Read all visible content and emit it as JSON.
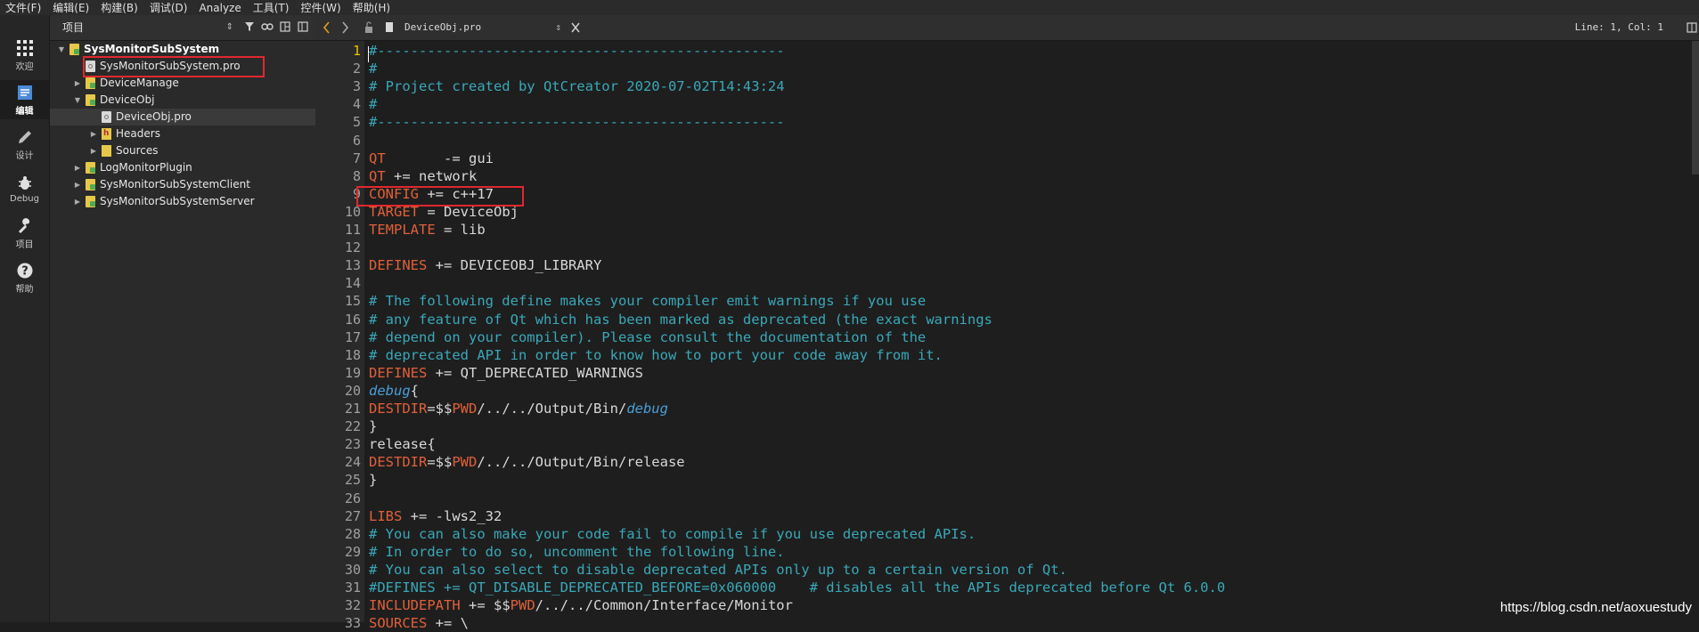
{
  "menu": [
    "文件(F)",
    "编辑(E)",
    "构建(B)",
    "调试(D)",
    "Analyze",
    "工具(T)",
    "控件(W)",
    "帮助(H)"
  ],
  "modes": [
    {
      "label": "欢迎",
      "icon": "grid-icon"
    },
    {
      "label": "编辑",
      "icon": "edit-doc-icon"
    },
    {
      "label": "设计",
      "icon": "pencil-icon"
    },
    {
      "label": "Debug",
      "icon": "bug-icon"
    },
    {
      "label": "项目",
      "icon": "wrench-icon"
    },
    {
      "label": "帮助",
      "icon": "help-icon"
    }
  ],
  "project_panel": {
    "title": "项目",
    "tree": [
      {
        "label": "SysMonitorSubSystem",
        "level": 0,
        "expand": "open",
        "icon": "folder",
        "bold": true
      },
      {
        "label": "SysMonitorSubSystem.pro",
        "level": 1,
        "expand": "none",
        "icon": "file"
      },
      {
        "label": "DeviceManage",
        "level": 1,
        "expand": "closed",
        "icon": "folder"
      },
      {
        "label": "DeviceObj",
        "level": 1,
        "expand": "open",
        "icon": "folder"
      },
      {
        "label": "DeviceObj.pro",
        "level": 2,
        "expand": "none",
        "icon": "file",
        "selected": true
      },
      {
        "label": "Headers",
        "level": 2,
        "expand": "closed",
        "icon": "hfolder"
      },
      {
        "label": "Sources",
        "level": 2,
        "expand": "closed",
        "icon": "sfolder"
      },
      {
        "label": "LogMonitorPlugin",
        "level": 1,
        "expand": "closed",
        "icon": "folder"
      },
      {
        "label": "SysMonitorSubSystemClient",
        "level": 1,
        "expand": "closed",
        "icon": "folder"
      },
      {
        "label": "SysMonitorSubSystemServer",
        "level": 1,
        "expand": "closed",
        "icon": "folder"
      }
    ]
  },
  "editor": {
    "doc_name": "DeviceObj.pro",
    "cursor_pos": "Line: 1, Col: 1",
    "lines": [
      [
        [
          "c-com",
          "#-------------------------------------------------"
        ]
      ],
      [
        [
          "c-com",
          "#"
        ]
      ],
      [
        [
          "c-com",
          "# Project created by QtCreator 2020-07-02T14:43:24"
        ]
      ],
      [
        [
          "c-com",
          "#"
        ]
      ],
      [
        [
          "c-com",
          "#-------------------------------------------------"
        ]
      ],
      [],
      [
        [
          "c-var",
          "QT"
        ],
        [
          "c-txt",
          "       -= gui"
        ]
      ],
      [
        [
          "c-var",
          "QT"
        ],
        [
          "c-txt",
          " += network"
        ]
      ],
      [
        [
          "c-var",
          "CONFIG"
        ],
        [
          "c-txt",
          " += c++17"
        ]
      ],
      [
        [
          "c-var",
          "TARGET"
        ],
        [
          "c-txt",
          " = DeviceObj"
        ]
      ],
      [
        [
          "c-var",
          "TEMPLATE"
        ],
        [
          "c-txt",
          " = lib"
        ]
      ],
      [],
      [
        [
          "c-var",
          "DEFINES"
        ],
        [
          "c-txt",
          " += DEVICEOBJ_LIBRARY"
        ]
      ],
      [],
      [
        [
          "c-com",
          "# The following define makes your compiler emit warnings if you use"
        ]
      ],
      [
        [
          "c-com",
          "# any feature of Qt which has been marked as deprecated (the exact warnings"
        ]
      ],
      [
        [
          "c-com",
          "# depend on your compiler). Please consult the documentation of the"
        ]
      ],
      [
        [
          "c-com",
          "# deprecated API in order to know how to port your code away from it."
        ]
      ],
      [
        [
          "c-var",
          "DEFINES"
        ],
        [
          "c-txt",
          " += QT_DEPRECATED_WARNINGS"
        ]
      ],
      [
        [
          "c-it",
          "debug"
        ],
        [
          "c-txt",
          "{"
        ]
      ],
      [
        [
          "c-var",
          "DESTDIR"
        ],
        [
          "c-txt",
          "=$$"
        ],
        [
          "c-var",
          "PWD"
        ],
        [
          "c-txt",
          "/../../Output/Bin/"
        ],
        [
          "c-it",
          "debug"
        ]
      ],
      [
        [
          "c-txt",
          "}"
        ]
      ],
      [
        [
          "c-txt",
          "release{"
        ]
      ],
      [
        [
          "c-var",
          "DESTDIR"
        ],
        [
          "c-txt",
          "=$$"
        ],
        [
          "c-var",
          "PWD"
        ],
        [
          "c-txt",
          "/../../Output/Bin/release"
        ]
      ],
      [
        [
          "c-txt",
          "}"
        ]
      ],
      [],
      [
        [
          "c-var",
          "LIBS"
        ],
        [
          "c-txt",
          " += -lws2_32"
        ]
      ],
      [
        [
          "c-com",
          "# You can also make your code fail to compile if you use deprecated APIs."
        ]
      ],
      [
        [
          "c-com",
          "# In order to do so, uncomment the following line."
        ]
      ],
      [
        [
          "c-com",
          "# You can also select to disable deprecated APIs only up to a certain version of Qt."
        ]
      ],
      [
        [
          "c-com",
          "#DEFINES += QT_DISABLE_DEPRECATED_BEFORE=0x060000    # disables all the APIs deprecated before Qt 6.0.0"
        ]
      ],
      [
        [
          "c-var",
          "INCLUDEPATH"
        ],
        [
          "c-txt",
          " += $$"
        ],
        [
          "c-var",
          "PWD"
        ],
        [
          "c-txt",
          "/../../Common/Interface/Monitor"
        ]
      ],
      [
        [
          "c-var",
          "SOURCES"
        ],
        [
          "c-txt",
          " += \\"
        ]
      ]
    ]
  },
  "watermark": "https://blog.csdn.net/aoxuestudy"
}
